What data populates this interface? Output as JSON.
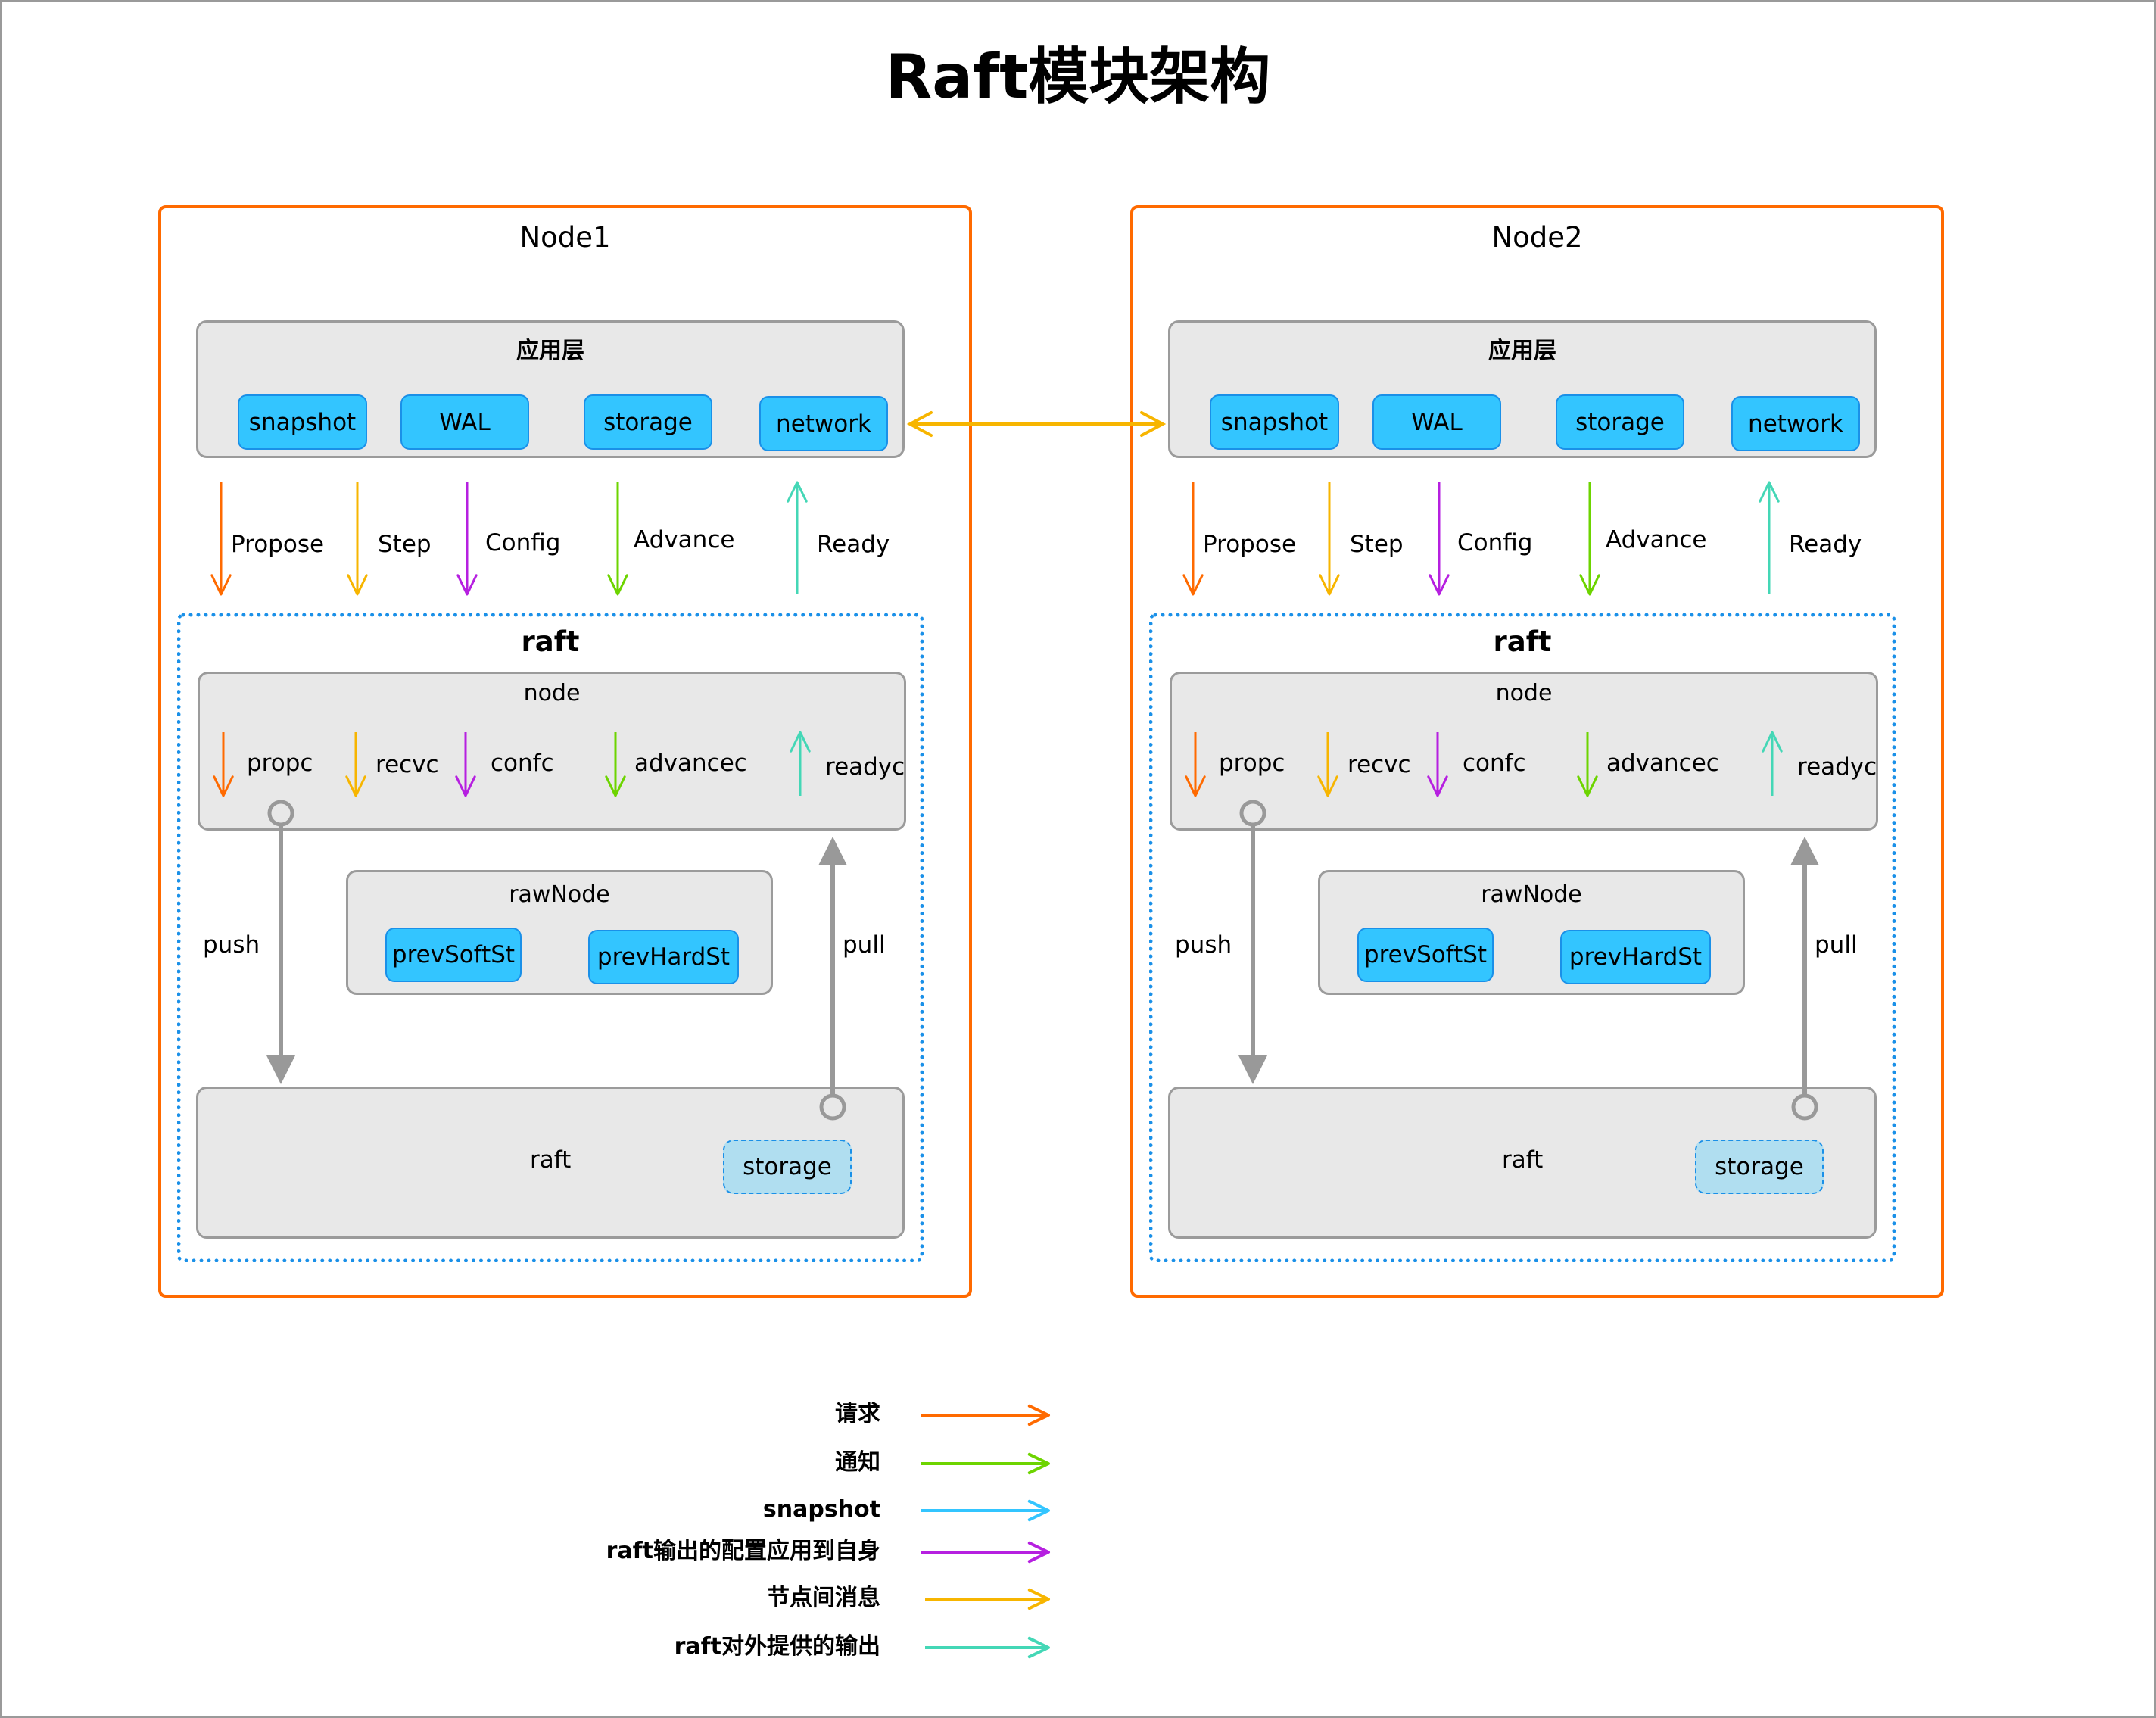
{
  "title": "Raft模块架构",
  "colors": {
    "request": "#ff6a00",
    "notify": "#6dd400",
    "snapshot": "#33c5ff",
    "config": "#b620e0",
    "peer_message": "#f7b500",
    "raft_output": "#44d7b6",
    "push_pull": "#999999",
    "node_border": "#ff6a00",
    "raft_border": "#1a90e8"
  },
  "nodes": [
    {
      "name": "Node1",
      "app_layer": {
        "label": "应用层",
        "chips": [
          "snapshot",
          "WAL",
          "storage",
          "network"
        ]
      },
      "interface_arrows": [
        {
          "label": "Propose",
          "direction": "down",
          "color_key": "request"
        },
        {
          "label": "Step",
          "direction": "down",
          "color_key": "peer_message"
        },
        {
          "label": "Config",
          "direction": "down",
          "color_key": "config"
        },
        {
          "label": "Advance",
          "direction": "down",
          "color_key": "notify"
        },
        {
          "label": "Ready",
          "direction": "up",
          "color_key": "raft_output"
        }
      ],
      "raft": {
        "label": "raft",
        "node_box": {
          "label": "node",
          "channels": [
            {
              "label": "propc",
              "direction": "down",
              "color_key": "request"
            },
            {
              "label": "recvc",
              "direction": "down",
              "color_key": "peer_message"
            },
            {
              "label": "confc",
              "direction": "down",
              "color_key": "config"
            },
            {
              "label": "advancec",
              "direction": "down",
              "color_key": "notify"
            },
            {
              "label": "readyc",
              "direction": "up",
              "color_key": "raft_output"
            }
          ]
        },
        "push_label": "push",
        "pull_label": "pull",
        "raw_node": {
          "label": "rawNode",
          "chips": [
            "prevSoftSt",
            "prevHardSt"
          ]
        },
        "raft_core": {
          "label": "raft",
          "storage_label": "storage"
        }
      }
    },
    {
      "name": "Node2",
      "app_layer": {
        "label": "应用层",
        "chips": [
          "snapshot",
          "WAL",
          "storage",
          "network"
        ]
      },
      "interface_arrows": [
        {
          "label": "Propose",
          "direction": "down",
          "color_key": "request"
        },
        {
          "label": "Step",
          "direction": "down",
          "color_key": "peer_message"
        },
        {
          "label": "Config",
          "direction": "down",
          "color_key": "config"
        },
        {
          "label": "Advance",
          "direction": "down",
          "color_key": "notify"
        },
        {
          "label": "Ready",
          "direction": "up",
          "color_key": "raft_output"
        }
      ],
      "raft": {
        "label": "raft",
        "node_box": {
          "label": "node",
          "channels": [
            {
              "label": "propc",
              "direction": "down",
              "color_key": "request"
            },
            {
              "label": "recvc",
              "direction": "down",
              "color_key": "peer_message"
            },
            {
              "label": "confc",
              "direction": "down",
              "color_key": "config"
            },
            {
              "label": "advancec",
              "direction": "down",
              "color_key": "notify"
            },
            {
              "label": "readyc",
              "direction": "up",
              "color_key": "raft_output"
            }
          ]
        },
        "push_label": "push",
        "pull_label": "pull",
        "raw_node": {
          "label": "rawNode",
          "chips": [
            "prevSoftSt",
            "prevHardSt"
          ]
        },
        "raft_core": {
          "label": "raft",
          "storage_label": "storage"
        }
      }
    }
  ],
  "inter_node_link": {
    "from": "Node1.network",
    "to": "Node2.network",
    "bidirectional": true,
    "color_key": "peer_message"
  },
  "legend": [
    {
      "label": "请求",
      "color_key": "request"
    },
    {
      "label": "通知",
      "color_key": "notify"
    },
    {
      "label": "snapshot",
      "color_key": "snapshot"
    },
    {
      "label": "raft输出的配置应用到自身",
      "color_key": "config"
    },
    {
      "label": "节点间消息",
      "color_key": "peer_message"
    },
    {
      "label": "raft对外提供的输出",
      "color_key": "raft_output"
    }
  ]
}
